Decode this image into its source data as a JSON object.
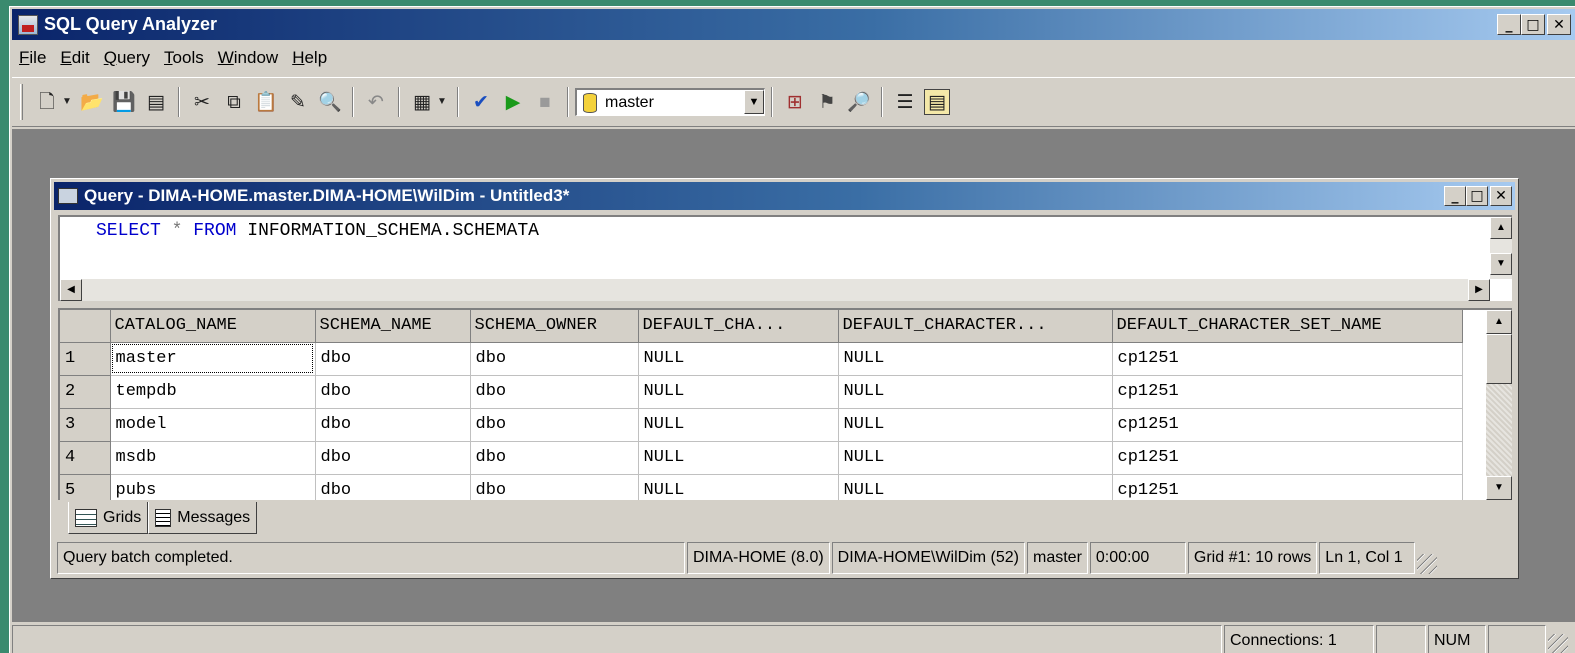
{
  "app": {
    "title": "SQL Query Analyzer",
    "menu": [
      "File",
      "Edit",
      "Query",
      "Tools",
      "Window",
      "Help"
    ],
    "database_selector": "master",
    "connections": "Connections: 1",
    "num_indicator": "NUM"
  },
  "query_window": {
    "title": "Query - DIMA-HOME.master.DIMA-HOME\\WilDim - Untitled3*",
    "sql": {
      "kw1": "SELECT",
      "op": "*",
      "kw2": "FROM",
      "rest": "INFORMATION_SCHEMA.SCHEMATA"
    },
    "grid": {
      "columns": [
        "CATALOG_NAME",
        "SCHEMA_NAME",
        "SCHEMA_OWNER",
        "DEFAULT_CHA...",
        "DEFAULT_CHARACTER...",
        "DEFAULT_CHARACTER_SET_NAME"
      ],
      "rows": [
        [
          "1",
          "master",
          "dbo",
          "dbo",
          "NULL",
          "NULL",
          "cp1251"
        ],
        [
          "2",
          "tempdb",
          "dbo",
          "dbo",
          "NULL",
          "NULL",
          "cp1251"
        ],
        [
          "3",
          "model",
          "dbo",
          "dbo",
          "NULL",
          "NULL",
          "cp1251"
        ],
        [
          "4",
          "msdb",
          "dbo",
          "dbo",
          "NULL",
          "NULL",
          "cp1251"
        ],
        [
          "5",
          "pubs",
          "dbo",
          "dbo",
          "NULL",
          "NULL",
          "cp1251"
        ]
      ]
    },
    "tabs": [
      "Grids",
      "Messages"
    ],
    "status": {
      "message": "Query batch completed.",
      "server": "DIMA-HOME (8.0)",
      "user": "DIMA-HOME\\WilDim (52)",
      "database": "master",
      "elapsed": "0:00:00",
      "rows": "Grid #1: 10 rows",
      "position": "Ln 1, Col 1"
    }
  }
}
